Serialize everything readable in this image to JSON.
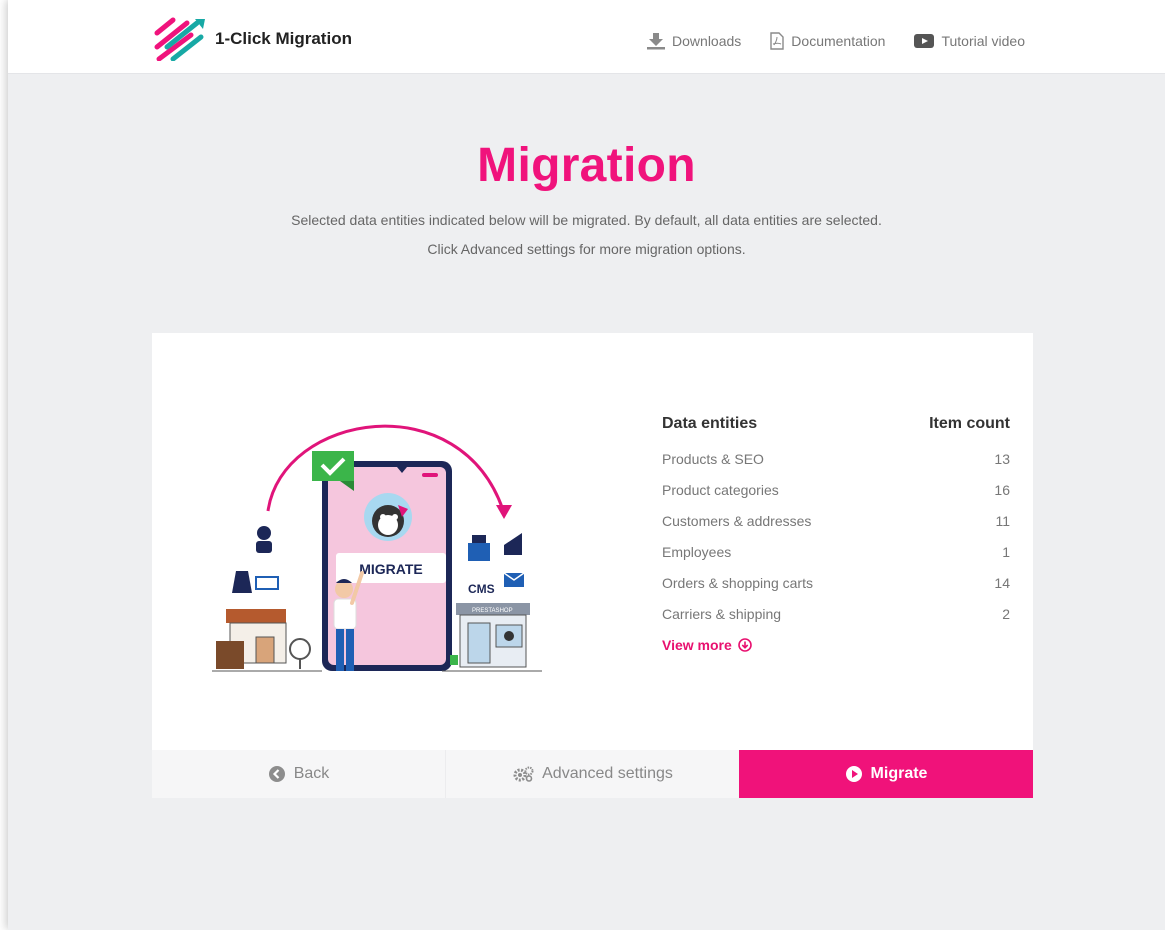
{
  "app": {
    "name": "1-Click Migration"
  },
  "nav": {
    "downloads": "Downloads",
    "documentation": "Documentation",
    "tutorial": "Tutorial video"
  },
  "page": {
    "title": "Migration",
    "subtitle_line1": "Selected data entities indicated below will be migrated. By default, all data entities are selected.",
    "subtitle_line2": "Click Advanced settings for more migration options."
  },
  "illustration": {
    "phone_label": "MIGRATE",
    "cms_label": "CMS",
    "shop_label": "PRESTASHOP"
  },
  "table": {
    "col_entities": "Data entities",
    "col_count": "Item count",
    "rows": [
      {
        "name": "Products & SEO",
        "count": "13"
      },
      {
        "name": "Product categories",
        "count": "16"
      },
      {
        "name": "Customers & addresses",
        "count": "11"
      },
      {
        "name": "Employees",
        "count": "1"
      },
      {
        "name": "Orders & shopping carts",
        "count": "14"
      },
      {
        "name": "Carriers & shipping",
        "count": "2"
      }
    ],
    "view_more": "View more"
  },
  "footer": {
    "back": "Back",
    "advanced": "Advanced settings",
    "migrate": "Migrate"
  },
  "colors": {
    "accent": "#f0137c",
    "teal": "#17a9a5",
    "background": "#eeeff1"
  }
}
